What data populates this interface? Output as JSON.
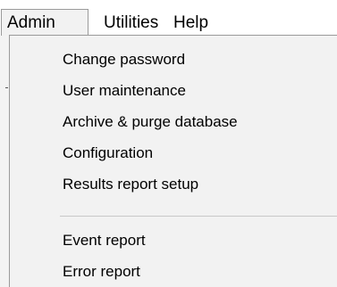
{
  "menubar": {
    "items": [
      {
        "label": "Admin"
      },
      {
        "label": "Utilities"
      },
      {
        "label": "Help"
      }
    ]
  },
  "admin_menu": {
    "items": [
      {
        "label": "Change password"
      },
      {
        "label": "User maintenance"
      },
      {
        "label": "Archive & purge database"
      },
      {
        "label": "Configuration"
      },
      {
        "label": "Results report setup"
      },
      {
        "label": "Event report"
      },
      {
        "label": "Error report"
      }
    ]
  },
  "colors": {
    "menu_background": "#f2f2f2",
    "border": "#9a9a9a",
    "separator": "#c8c8c8",
    "text": "#000000"
  }
}
